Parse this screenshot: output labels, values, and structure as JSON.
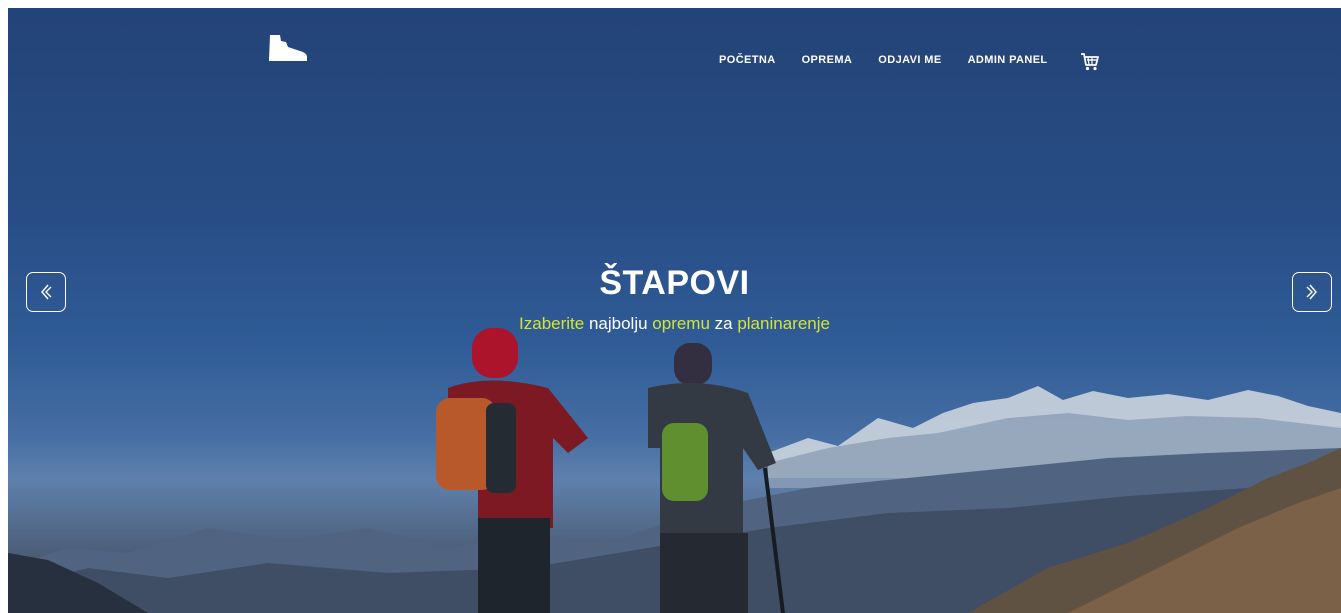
{
  "brand": {
    "logo_icon": "hiking-boot-icon"
  },
  "nav": {
    "items": [
      {
        "label": "POČETNA"
      },
      {
        "label": "OPREMA"
      },
      {
        "label": "ODJAVI ME"
      },
      {
        "label": "ADMIN PANEL"
      }
    ],
    "cart_icon": "shopping-cart-icon"
  },
  "hero": {
    "title": "ŠTAPOVI",
    "subtitle": {
      "w1": "Izaberite",
      "w2": " najbolju ",
      "w3": "opremu",
      "w4": " za ",
      "w5": "planinarenje"
    },
    "prev_icon": "chevron-left-icon",
    "next_icon": "chevron-right-icon"
  },
  "colors": {
    "accent": "#d5e23a",
    "text": "#ffffff",
    "sky": "#2d5592"
  }
}
